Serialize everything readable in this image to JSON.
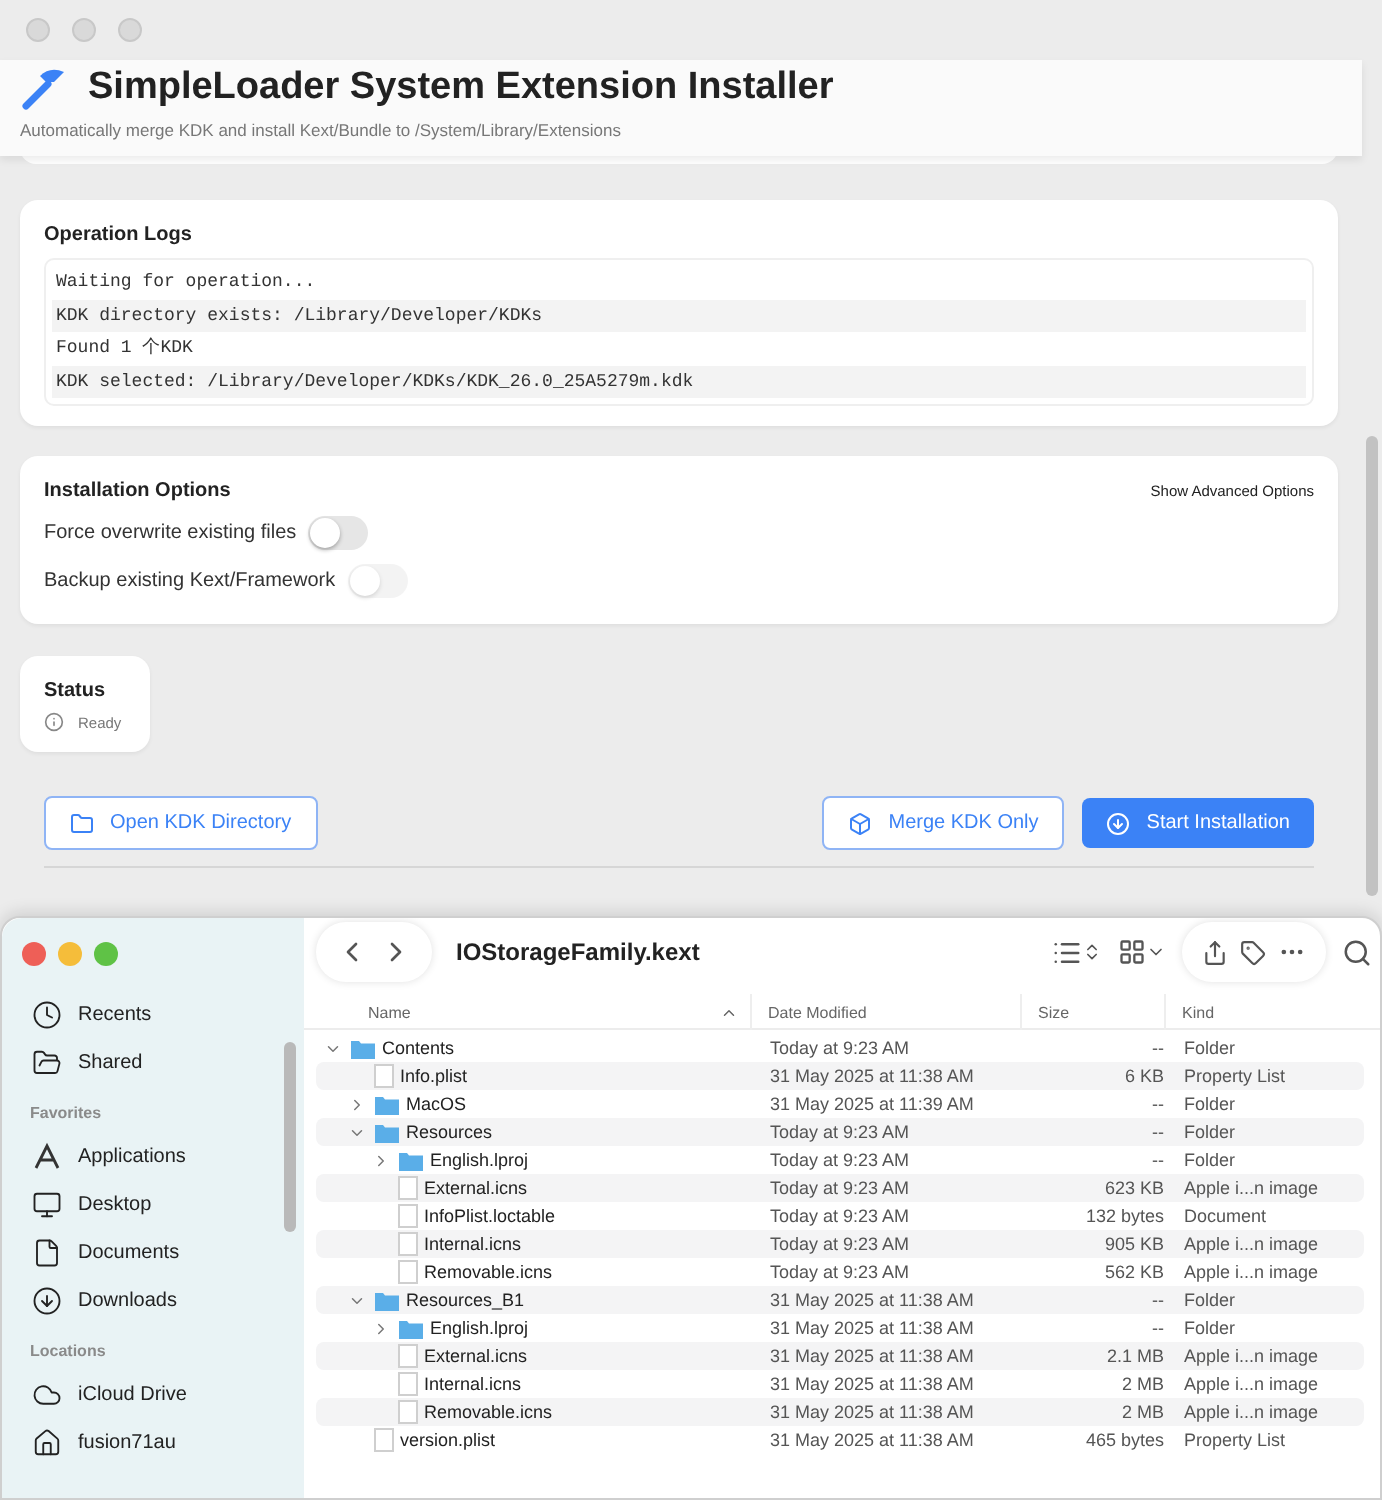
{
  "app": {
    "title": "SimpleLoader System Extension Installer",
    "subtitle": "Automatically merge KDK and install Kext/Bundle to /System/Library/Extensions",
    "logs": {
      "title": "Operation Logs",
      "lines": [
        "Waiting for operation...",
        "KDK directory exists: /Library/Developer/KDKs",
        "Found 1 个KDK",
        "KDK selected: /Library/Developer/KDKs/KDK_26.0_25A5279m.kdk"
      ]
    },
    "options": {
      "title": "Installation Options",
      "advanced_link": "Show Advanced Options",
      "items": [
        {
          "label": "Force overwrite existing files",
          "on": false,
          "disabled": false
        },
        {
          "label": "Backup existing Kext/Framework",
          "on": false,
          "disabled": true
        }
      ]
    },
    "status": {
      "title": "Status",
      "text": "Ready"
    },
    "buttons": [
      {
        "label": "Open KDK Directory",
        "kind": "outline"
      },
      {
        "label": "Merge KDK Only",
        "kind": "outline"
      },
      {
        "label": "Start Installation",
        "kind": "primary"
      }
    ]
  },
  "finder": {
    "title": "IOStorageFamily.kext",
    "sidebar": [
      {
        "items": [
          "Recents",
          "Shared"
        ]
      },
      {
        "heading": "Favorites",
        "items": [
          "Applications",
          "Desktop",
          "Documents",
          "Downloads"
        ]
      },
      {
        "heading": "Locations",
        "items": [
          "iCloud Drive",
          "fusion71au"
        ]
      }
    ],
    "columns": [
      "Name",
      "Date Modified",
      "Size",
      "Kind"
    ],
    "rows": [
      {
        "name": "Contents",
        "date": "Today at 9:23 AM",
        "size": "--",
        "kind": "Folder",
        "expanded": true,
        "children": [
          {
            "name": "Info.plist",
            "date": "31 May 2025 at 11:38 AM",
            "size": "6 KB",
            "kind": "Property List"
          },
          {
            "name": "MacOS",
            "date": "31 May 2025 at 11:39 AM",
            "size": "--",
            "kind": "Folder",
            "expanded": false
          },
          {
            "name": "Resources",
            "date": "Today at 9:23 AM",
            "size": "--",
            "kind": "Folder",
            "expanded": true,
            "children": [
              {
                "name": "English.lproj",
                "date": "Today at 9:23 AM",
                "size": "--",
                "kind": "Folder",
                "expanded": false
              },
              {
                "name": "External.icns",
                "date": "Today at 9:23 AM",
                "size": "623 KB",
                "kind": "Apple i...n image"
              },
              {
                "name": "InfoPlist.loctable",
                "date": "Today at 9:23 AM",
                "size": "132 bytes",
                "kind": "Document"
              },
              {
                "name": "Internal.icns",
                "date": "Today at 9:23 AM",
                "size": "905 KB",
                "kind": "Apple i...n image"
              },
              {
                "name": "Removable.icns",
                "date": "Today at 9:23 AM",
                "size": "562 KB",
                "kind": "Apple i...n image"
              }
            ]
          },
          {
            "name": "Resources_B1",
            "date": "31 May 2025 at 11:38 AM",
            "size": "--",
            "kind": "Folder",
            "expanded": true,
            "children": [
              {
                "name": "English.lproj",
                "date": "31 May 2025 at 11:38 AM",
                "size": "--",
                "kind": "Folder",
                "expanded": false
              },
              {
                "name": "External.icns",
                "date": "31 May 2025 at 11:38 AM",
                "size": "2.1 MB",
                "kind": "Apple i...n image"
              },
              {
                "name": "Internal.icns",
                "date": "31 May 2025 at 11:38 AM",
                "size": "2 MB",
                "kind": "Apple i...n image"
              },
              {
                "name": "Removable.icns",
                "date": "31 May 2025 at 11:38 AM",
                "size": "2 MB",
                "kind": "Apple i...n image"
              }
            ]
          },
          {
            "name": "version.plist",
            "date": "31 May 2025 at 11:38 AM",
            "size": "465 bytes",
            "kind": "Property List"
          }
        ]
      }
    ]
  }
}
